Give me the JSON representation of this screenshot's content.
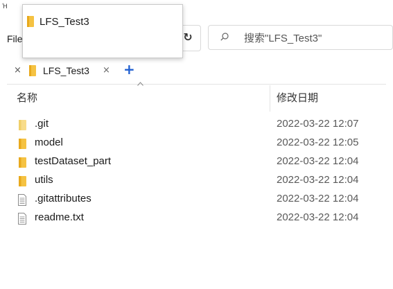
{
  "window": {
    "title_glyph": "Ή"
  },
  "menu": {
    "file_label": "File"
  },
  "dropdown": {
    "item_label": "LFS_Test3"
  },
  "search": {
    "placeholder": "搜索\"LFS_Test3\""
  },
  "tabs": [
    {
      "label": "LFS_Test3",
      "close": "×"
    }
  ],
  "tab_close_left": "×",
  "tab_add": "+",
  "columns": {
    "name": "名称",
    "date": "修改日期"
  },
  "rows": [
    {
      "name": ".git",
      "date": "2022-03-22 12:07",
      "type": "folder",
      "icon": "folder-icon",
      "light": true
    },
    {
      "name": "model",
      "date": "2022-03-22 12:05",
      "type": "folder",
      "icon": "folder-icon",
      "light": false
    },
    {
      "name": "testDataset_part",
      "date": "2022-03-22 12:04",
      "type": "folder",
      "icon": "folder-icon",
      "light": false
    },
    {
      "name": "utils",
      "date": "2022-03-22 12:04",
      "type": "folder",
      "icon": "folder-icon",
      "light": false
    },
    {
      "name": ".gitattributes",
      "date": "2022-03-22 12:04",
      "type": "file",
      "icon": "file-icon",
      "light": false
    },
    {
      "name": "readme.txt",
      "date": "2022-03-22 12:04",
      "type": "file",
      "icon": "file-icon",
      "light": false
    }
  ],
  "colors": {
    "accent": "#1f5fd1",
    "folder": "#f5c242",
    "folder_dark": "#e8a91d"
  }
}
